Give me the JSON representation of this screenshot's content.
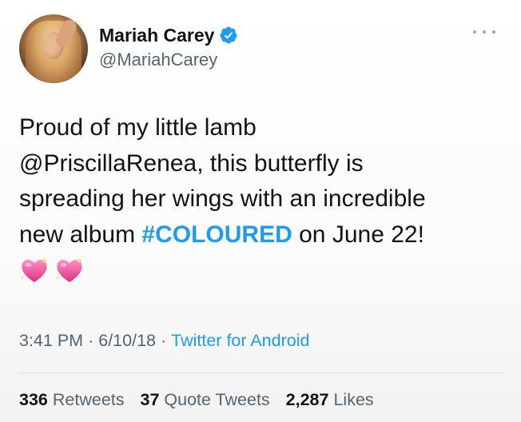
{
  "user": {
    "display_name": "Mariah Carey",
    "handle": "@MariahCarey",
    "verified": true,
    "avatar_icon": "profile-photo"
  },
  "tweet": {
    "lines": [
      "Proud of my little lamb",
      "@PriscillaRenea, this butterfly is",
      "spreading her wings with an incredible"
    ],
    "last_line_prefix": "new album ",
    "hashtag": "#COLOURED",
    "last_line_suffix": " on June 22!",
    "emojis": [
      "sparkling-heart-emoji",
      "sparkling-heart-emoji"
    ]
  },
  "meta": {
    "time": "3:41 PM",
    "dot1": "·",
    "date": "6/10/18",
    "dot2": "·",
    "source": "Twitter for Android"
  },
  "stats": {
    "retweets_count": "336",
    "retweets_label": "Retweets",
    "quotes_count": "37",
    "quotes_label": "Quote Tweets",
    "likes_count": "2,287",
    "likes_label": "Likes"
  },
  "colors": {
    "accent": "#1d9bf0",
    "text": "#0f1419",
    "secondary": "#536471"
  }
}
